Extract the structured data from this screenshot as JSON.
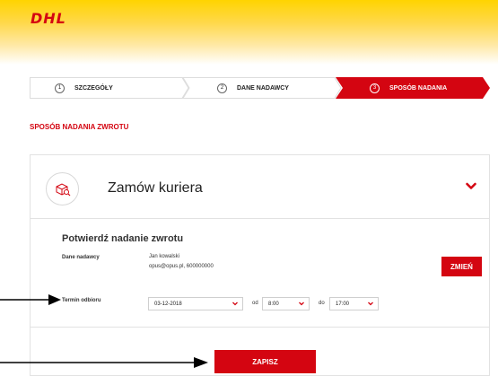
{
  "header": {
    "logo_text": "DHL"
  },
  "steps": [
    {
      "number": "1",
      "label": "SZCZEGÓŁY"
    },
    {
      "number": "2",
      "label": "DANE NADAWCY"
    },
    {
      "number": "3",
      "label": "SPOSÓB NADANIA"
    }
  ],
  "section_title": "SPOSÓB NADANIA ZWROTU",
  "card": {
    "title": "Zamów kuriera",
    "subtitle": "Potwierdź nadanie zwrotu",
    "sender_label": "Dane nadawcy",
    "sender_name": "Jan kowalski",
    "sender_contact": "opus@opus.pl, 600000000",
    "change_button": "ZMIEŃ",
    "pickup_label": "Termin odbioru",
    "date_value": "03-12-2018",
    "from_label": "od",
    "from_value": "8:00",
    "to_label": "do",
    "to_value": "17:00",
    "save_button": "ZAPISZ"
  },
  "colors": {
    "brand_red": "#d40511",
    "brand_yellow": "#ffd400"
  }
}
